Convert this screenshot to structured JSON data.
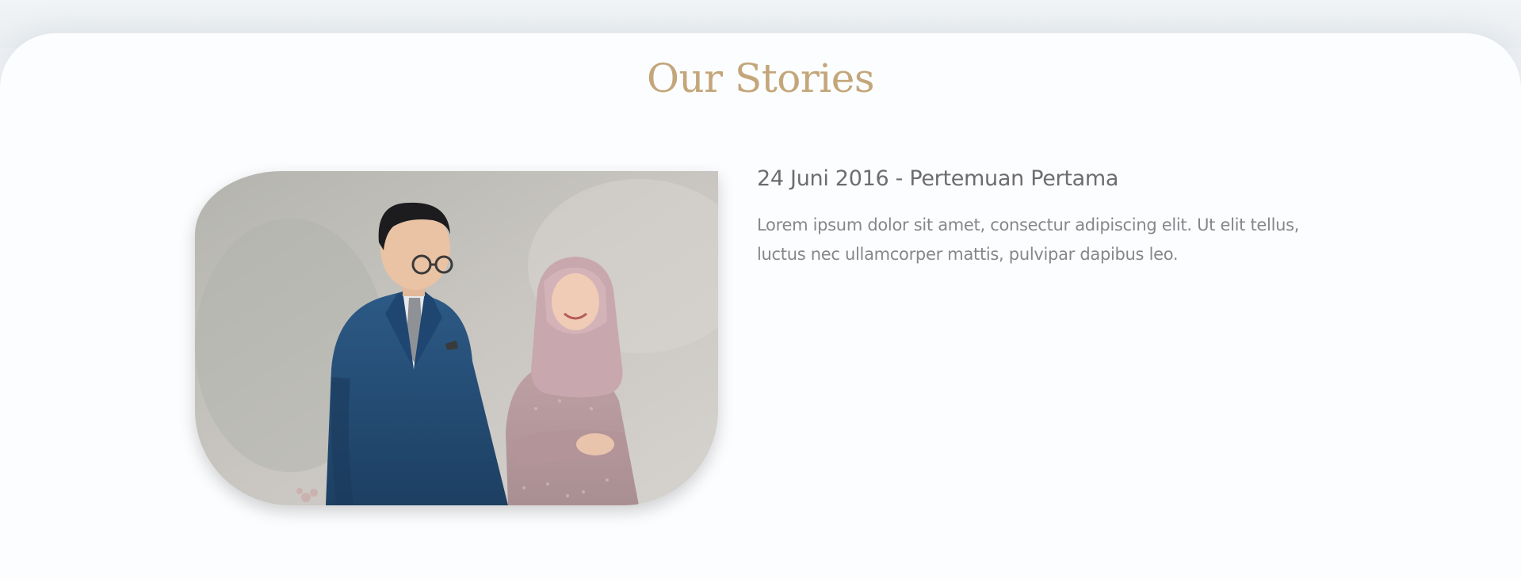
{
  "section": {
    "title": "Our Stories"
  },
  "story": {
    "date_title": "24 Juni 2016 - Pertemuan Pertama",
    "description": "Lorem ipsum dolor sit amet, consectur adipiscing elit. Ut elit tellus, luctus nec ullamcorper mattis, pulvipar dapibus leo."
  },
  "colors": {
    "title": "#c3a67a",
    "heading": "#6d6d70",
    "body_text": "#86878b",
    "background": "#fcfdfe"
  }
}
